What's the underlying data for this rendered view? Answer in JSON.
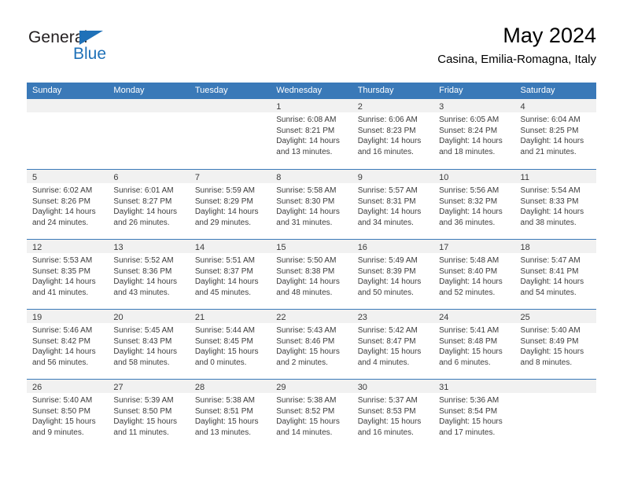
{
  "brand": {
    "name_top": "General",
    "name_bottom": "Blue",
    "triangle_color": "#1f71b8",
    "text_color": "#231f20"
  },
  "header": {
    "title": "May 2024",
    "subtitle": "Casina, Emilia-Romagna, Italy"
  },
  "theme": {
    "header_blue": "#3a79b8",
    "day_strip_gray": "#f1f1f1",
    "text_gray": "#3c3c3c",
    "white": "#ffffff"
  },
  "weekdays": [
    "Sunday",
    "Monday",
    "Tuesday",
    "Wednesday",
    "Thursday",
    "Friday",
    "Saturday"
  ],
  "weeks": [
    [
      {
        "day": "",
        "lines": []
      },
      {
        "day": "",
        "lines": []
      },
      {
        "day": "",
        "lines": []
      },
      {
        "day": "1",
        "lines": [
          "Sunrise: 6:08 AM",
          "Sunset: 8:21 PM",
          "Daylight: 14 hours",
          "and 13 minutes."
        ]
      },
      {
        "day": "2",
        "lines": [
          "Sunrise: 6:06 AM",
          "Sunset: 8:23 PM",
          "Daylight: 14 hours",
          "and 16 minutes."
        ]
      },
      {
        "day": "3",
        "lines": [
          "Sunrise: 6:05 AM",
          "Sunset: 8:24 PM",
          "Daylight: 14 hours",
          "and 18 minutes."
        ]
      },
      {
        "day": "4",
        "lines": [
          "Sunrise: 6:04 AM",
          "Sunset: 8:25 PM",
          "Daylight: 14 hours",
          "and 21 minutes."
        ]
      }
    ],
    [
      {
        "day": "5",
        "lines": [
          "Sunrise: 6:02 AM",
          "Sunset: 8:26 PM",
          "Daylight: 14 hours",
          "and 24 minutes."
        ]
      },
      {
        "day": "6",
        "lines": [
          "Sunrise: 6:01 AM",
          "Sunset: 8:27 PM",
          "Daylight: 14 hours",
          "and 26 minutes."
        ]
      },
      {
        "day": "7",
        "lines": [
          "Sunrise: 5:59 AM",
          "Sunset: 8:29 PM",
          "Daylight: 14 hours",
          "and 29 minutes."
        ]
      },
      {
        "day": "8",
        "lines": [
          "Sunrise: 5:58 AM",
          "Sunset: 8:30 PM",
          "Daylight: 14 hours",
          "and 31 minutes."
        ]
      },
      {
        "day": "9",
        "lines": [
          "Sunrise: 5:57 AM",
          "Sunset: 8:31 PM",
          "Daylight: 14 hours",
          "and 34 minutes."
        ]
      },
      {
        "day": "10",
        "lines": [
          "Sunrise: 5:56 AM",
          "Sunset: 8:32 PM",
          "Daylight: 14 hours",
          "and 36 minutes."
        ]
      },
      {
        "day": "11",
        "lines": [
          "Sunrise: 5:54 AM",
          "Sunset: 8:33 PM",
          "Daylight: 14 hours",
          "and 38 minutes."
        ]
      }
    ],
    [
      {
        "day": "12",
        "lines": [
          "Sunrise: 5:53 AM",
          "Sunset: 8:35 PM",
          "Daylight: 14 hours",
          "and 41 minutes."
        ]
      },
      {
        "day": "13",
        "lines": [
          "Sunrise: 5:52 AM",
          "Sunset: 8:36 PM",
          "Daylight: 14 hours",
          "and 43 minutes."
        ]
      },
      {
        "day": "14",
        "lines": [
          "Sunrise: 5:51 AM",
          "Sunset: 8:37 PM",
          "Daylight: 14 hours",
          "and 45 minutes."
        ]
      },
      {
        "day": "15",
        "lines": [
          "Sunrise: 5:50 AM",
          "Sunset: 8:38 PM",
          "Daylight: 14 hours",
          "and 48 minutes."
        ]
      },
      {
        "day": "16",
        "lines": [
          "Sunrise: 5:49 AM",
          "Sunset: 8:39 PM",
          "Daylight: 14 hours",
          "and 50 minutes."
        ]
      },
      {
        "day": "17",
        "lines": [
          "Sunrise: 5:48 AM",
          "Sunset: 8:40 PM",
          "Daylight: 14 hours",
          "and 52 minutes."
        ]
      },
      {
        "day": "18",
        "lines": [
          "Sunrise: 5:47 AM",
          "Sunset: 8:41 PM",
          "Daylight: 14 hours",
          "and 54 minutes."
        ]
      }
    ],
    [
      {
        "day": "19",
        "lines": [
          "Sunrise: 5:46 AM",
          "Sunset: 8:42 PM",
          "Daylight: 14 hours",
          "and 56 minutes."
        ]
      },
      {
        "day": "20",
        "lines": [
          "Sunrise: 5:45 AM",
          "Sunset: 8:43 PM",
          "Daylight: 14 hours",
          "and 58 minutes."
        ]
      },
      {
        "day": "21",
        "lines": [
          "Sunrise: 5:44 AM",
          "Sunset: 8:45 PM",
          "Daylight: 15 hours",
          "and 0 minutes."
        ]
      },
      {
        "day": "22",
        "lines": [
          "Sunrise: 5:43 AM",
          "Sunset: 8:46 PM",
          "Daylight: 15 hours",
          "and 2 minutes."
        ]
      },
      {
        "day": "23",
        "lines": [
          "Sunrise: 5:42 AM",
          "Sunset: 8:47 PM",
          "Daylight: 15 hours",
          "and 4 minutes."
        ]
      },
      {
        "day": "24",
        "lines": [
          "Sunrise: 5:41 AM",
          "Sunset: 8:48 PM",
          "Daylight: 15 hours",
          "and 6 minutes."
        ]
      },
      {
        "day": "25",
        "lines": [
          "Sunrise: 5:40 AM",
          "Sunset: 8:49 PM",
          "Daylight: 15 hours",
          "and 8 minutes."
        ]
      }
    ],
    [
      {
        "day": "26",
        "lines": [
          "Sunrise: 5:40 AM",
          "Sunset: 8:50 PM",
          "Daylight: 15 hours",
          "and 9 minutes."
        ]
      },
      {
        "day": "27",
        "lines": [
          "Sunrise: 5:39 AM",
          "Sunset: 8:50 PM",
          "Daylight: 15 hours",
          "and 11 minutes."
        ]
      },
      {
        "day": "28",
        "lines": [
          "Sunrise: 5:38 AM",
          "Sunset: 8:51 PM",
          "Daylight: 15 hours",
          "and 13 minutes."
        ]
      },
      {
        "day": "29",
        "lines": [
          "Sunrise: 5:38 AM",
          "Sunset: 8:52 PM",
          "Daylight: 15 hours",
          "and 14 minutes."
        ]
      },
      {
        "day": "30",
        "lines": [
          "Sunrise: 5:37 AM",
          "Sunset: 8:53 PM",
          "Daylight: 15 hours",
          "and 16 minutes."
        ]
      },
      {
        "day": "31",
        "lines": [
          "Sunrise: 5:36 AM",
          "Sunset: 8:54 PM",
          "Daylight: 15 hours",
          "and 17 minutes."
        ]
      },
      {
        "day": "",
        "lines": []
      }
    ]
  ]
}
